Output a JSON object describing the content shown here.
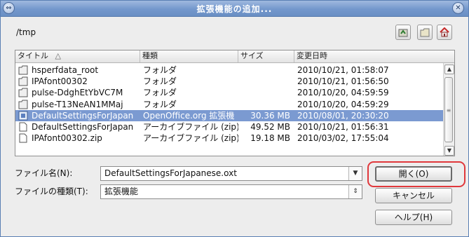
{
  "window": {
    "title": "拡張機能の追加..."
  },
  "location": {
    "path": "/tmp"
  },
  "toolbar": {
    "buttons": [
      {
        "name": "up-folder-icon"
      },
      {
        "name": "new-folder-icon"
      },
      {
        "name": "home-icon"
      }
    ]
  },
  "file_list": {
    "columns": [
      "タイトル",
      "種類",
      "サイズ",
      "変更日時"
    ],
    "sort_indicator": "△",
    "rows": [
      {
        "name": "hsperfdata_root",
        "type": "フォルダ",
        "size": "",
        "modified": "2010/10/21, 01:58:07",
        "icon": "folder-icon",
        "selected": false
      },
      {
        "name": "IPAfont00302",
        "type": "フォルダ",
        "size": "",
        "modified": "2010/10/21, 01:56:50",
        "icon": "folder-icon",
        "selected": false
      },
      {
        "name": "pulse-DdghEtYbVC7M",
        "type": "フォルダ",
        "size": "",
        "modified": "2010/10/20, 04:59:59",
        "icon": "folder-icon",
        "selected": false
      },
      {
        "name": "pulse-T13NeAN1MMaj",
        "type": "フォルダ",
        "size": "",
        "modified": "2010/10/20, 04:59:29",
        "icon": "folder-icon",
        "selected": false
      },
      {
        "name": "DefaultSettingsForJapan",
        "type": "OpenOffice.org 拡張機",
        "size": "30.36 MB",
        "modified": "2010/08/01, 20:30:20",
        "icon": "extension-icon",
        "selected": true
      },
      {
        "name": "DefaultSettingsForJapan",
        "type": "アーカイブファイル (zip)",
        "size": "49.52 MB",
        "modified": "2010/10/21, 01:56:31",
        "icon": "file-icon",
        "selected": false
      },
      {
        "name": "IPAfont00302.zip",
        "type": "アーカイブファイル (zip)",
        "size": "19.18 MB",
        "modified": "2010/03/02, 17:55:04",
        "icon": "file-icon",
        "selected": false
      }
    ]
  },
  "form": {
    "filename_label": "ファイル名(N):",
    "filename_value": "DefaultSettingsForJapanese.oxt",
    "filetype_label": "ファイルの種類(T):",
    "filetype_value": "拡張機能"
  },
  "buttons": {
    "open": "開く(O)",
    "cancel": "キャンセル",
    "help": "ヘルプ(H)"
  },
  "colors": {
    "titlebar": "#7397cc",
    "selection": "#7b9ad1",
    "highlight_ring": "#e0383c"
  }
}
